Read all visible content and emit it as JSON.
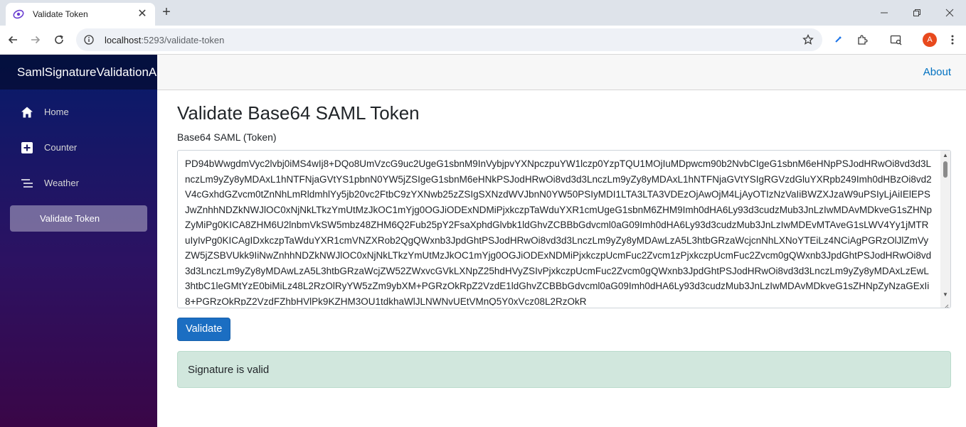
{
  "browser": {
    "tab_title": "Validate Token",
    "url_host": "localhost",
    "url_rest": ":5293/validate-token",
    "profile_initial": "A"
  },
  "app": {
    "brand": "SamlSignatureValidationApp",
    "about_label": "About",
    "nav": [
      {
        "label": "Home",
        "icon": "home-icon"
      },
      {
        "label": "Counter",
        "icon": "plus-square-icon"
      },
      {
        "label": "Weather",
        "icon": "list-icon"
      },
      {
        "label": "Validate Token",
        "icon": "none",
        "active": true
      }
    ]
  },
  "page": {
    "title": "Validate Base64 SAML Token",
    "field_label": "Base64 SAML (Token)",
    "token_value": "PD94bWwgdmVyc2lvbj0iMS4wIj8+DQo8UmVzcG9uc2UgeG1sbnM9InVybjpvYXNpczpuYW1lczp0YzpTQU1MOjIuMDpwcm90b2NvbCIgeG1sbnM6eHNpPSJodHRwOi8vd3d3LnczLm9yZy8yMDAxL1hNTFNjaGVtYS1pbnN0YW5jZSIgeG1sbnM6eHNkPSJodHRwOi8vd3d3LnczLm9yZy8yMDAxL1hNTFNjaGVtYSIgRGVzdGluYXRpb249Imh0dHBzOi8vd2V4cGxhdGZvcm0tZnNhLmRldmhlYy5jb20vc2FtbC9zYXNwb25zZSIgSXNzdWVJbnN0YW50PSIyMDI1LTA3LTA3VDEzOjAwOjM4LjAyOTIzNzVaIiBWZXJzaW9uPSIyLjAiIElEPSJwZnhhNDZkNWJlOC0xNjNkLTkzYmUtMzJkOC1mYjg0OGJiODExNDMiPjxkczpTaWduYXR1cmUgeG1sbnM6ZHM9Imh0dHA6Ly93d3cudzMub3JnLzIwMDAvMDkveG1sZHNpZyMiPg0KICA8ZHM6U2lnbmVkSW5mbz48ZHM6Q2Fub25pY2FsaXphdGlvbk1ldGhvZCBBbGdvcml0aG09Imh0dHA6Ly93d3cudzMub3JnLzIwMDEvMTAveG1sLWV4Yy1jMTRuIyIvPg0KICAgIDxkczpTaWduYXR1cmVNZXRob2QgQWxnb3JpdGhtPSJodHRwOi8vd3d3LnczLm9yZy8yMDAwLzA5L3htbGRzaWcjcnNhLXNoYTEiLz4NCiAgPGRzOlJlZmVyZW5jZSBVUkk9IiNwZnhhNDZkNWJlOC0xNjNkLTkzYmUtMzJkOC1mYjg0OGJiODExNDMiPjxkczpUcmFuc2Zvcm1zPjxkczpUcmFuc2Zvcm0gQWxnb3JpdGhtPSJodHRwOi8vd3d3LnczLm9yZy8yMDAwLzA5L3htbGRzaWcjZW52ZWxvcGVkLXNpZ25hdHVyZSIvPjxkczpUcmFuc2Zvcm0gQWxnb3JpdGhtPSJodHRwOi8vd3d3LnczLm9yZy8yMDAxLzEwL3htbC1leGMtYzE0biMiLz48L2RzOlRyYW5zZm9ybXM+PGRzOkRpZ2VzdE1ldGhvZCBBbGdvcml0aG09Imh0dHA6Ly93d3cudzMub3JnLzIwMDAvMDkveG1sZHNpZyNzaGExIi8+PGRzOkRpZ2VzdFZhbHVlPk9KZHM3OU1tdkhaWlJLNWNvUEtVMnQ5Y0xVcz08L2RzOkR",
    "validate_label": "Validate",
    "result_message": "Signature is valid"
  },
  "colors": {
    "accent": "#1b6ec2",
    "link": "#0071c1",
    "success_bg": "#d1e7dd",
    "sidebar_top": "#061b6a",
    "sidebar_bottom": "#3a0647"
  }
}
